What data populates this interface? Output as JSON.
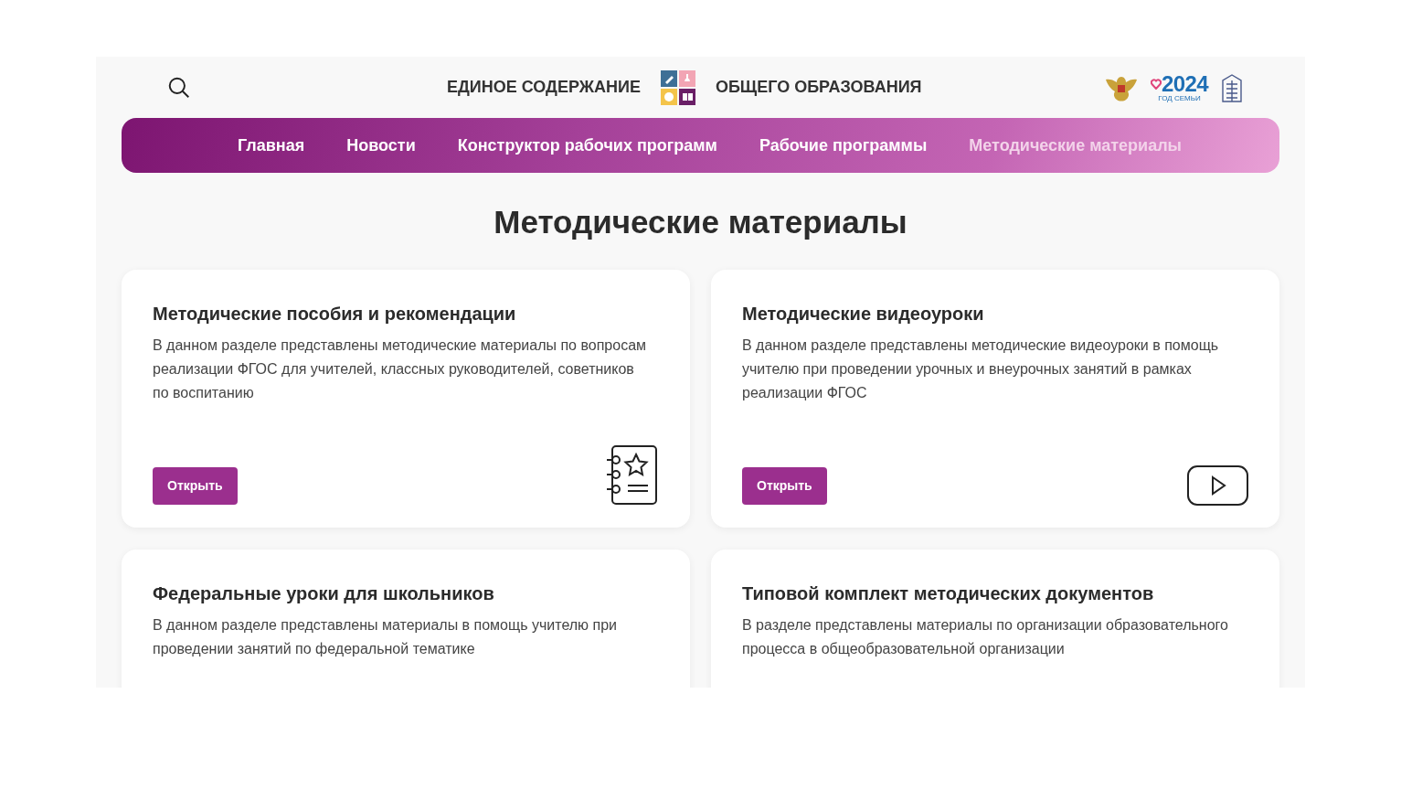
{
  "header": {
    "title_left": "ЕДИНОЕ СОДЕРЖАНИЕ",
    "title_right": "ОБЩЕГО ОБРАЗОВАНИЯ",
    "year_logo": {
      "year": "2024",
      "caption": "ГОД СЕМЬИ"
    }
  },
  "nav": [
    {
      "label": "Главная",
      "selected": false
    },
    {
      "label": "Новости",
      "selected": false
    },
    {
      "label": "Конструктор рабочих программ",
      "selected": false
    },
    {
      "label": "Рабочие программы",
      "selected": false
    },
    {
      "label": "Методические материалы",
      "selected": true
    }
  ],
  "page_title": "Методические материалы",
  "cards": [
    {
      "title": "Методические пособия и рекомендации",
      "description": "В данном разделе представлены методические материалы по вопросам реализации ФГОС для учителей, классных руководителей, советников по воспитанию",
      "button": "Открыть",
      "kind": "notebook"
    },
    {
      "title": "Методические видеоуроки",
      "description": "В данном разделе представлены методические видеоуроки в помощь учителю при проведении урочных и внеурочных занятий в рамках реализации ФГОС",
      "button": "Открыть",
      "kind": "video"
    },
    {
      "title": "Федеральные уроки для школьников",
      "description": "В данном разделе представлены материалы в помощь учителю при проведении занятий по федеральной тематике"
    },
    {
      "title": "Типовой комплект методических документов",
      "description": "В разделе представлены материалы по организации образовательного процесса в общеобразовательной организации"
    }
  ]
}
